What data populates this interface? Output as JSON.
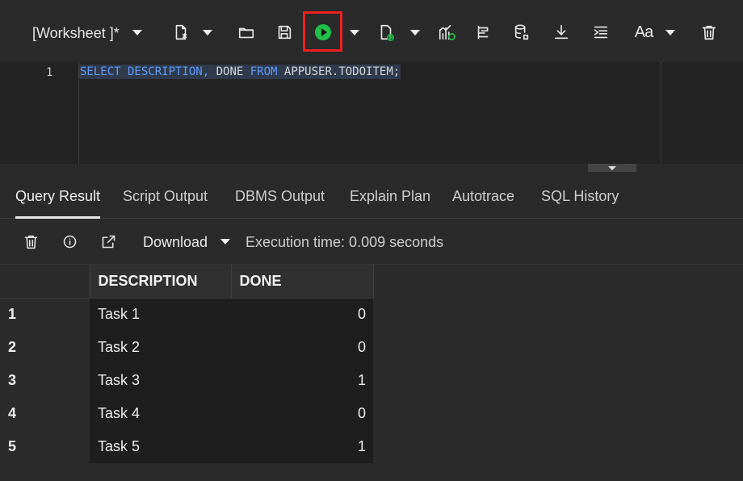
{
  "toolbar": {
    "worksheet_title": "[Worksheet ]*",
    "font_button_label": "Aa",
    "icons": [
      "new-document-icon",
      "folder-open-icon",
      "save-icon",
      "run-icon",
      "run-script-icon",
      "chart-icon",
      "tree-icon",
      "database-icon",
      "download-icon",
      "format-indent-icon",
      "font-icon",
      "trash-icon"
    ],
    "run_highlight_color": "#ef1f1f",
    "run_color": "#20c04a"
  },
  "editor": {
    "line_number": "1",
    "sql_parts": {
      "select": "SELECT",
      "description": " DESCRIPTION, ",
      "done": "DONE ",
      "from": "FROM",
      "table": " APPUSER.TODOITEM;"
    },
    "keyword_color": "#5d9cff"
  },
  "tabs": [
    {
      "label": "Query Result",
      "active": true
    },
    {
      "label": "Script Output",
      "active": false
    },
    {
      "label": "DBMS Output",
      "active": false
    },
    {
      "label": "Explain Plan",
      "active": false
    },
    {
      "label": "Autotrace",
      "active": false
    },
    {
      "label": "SQL History",
      "active": false
    }
  ],
  "result_toolbar": {
    "download_label": "Download",
    "execution_time": "Execution time: 0.009 seconds",
    "icons": [
      "trash-icon",
      "info-icon",
      "open-external-icon",
      "chevron-down-icon"
    ]
  },
  "results": {
    "columns": [
      "DESCRIPTION",
      "DONE"
    ],
    "rows": [
      {
        "num": "1",
        "description": "Task 1",
        "done": "0"
      },
      {
        "num": "2",
        "description": "Task 2",
        "done": "0"
      },
      {
        "num": "3",
        "description": "Task 3",
        "done": "1"
      },
      {
        "num": "4",
        "description": "Task 4",
        "done": "0"
      },
      {
        "num": "5",
        "description": "Task 5",
        "done": "1"
      }
    ]
  }
}
